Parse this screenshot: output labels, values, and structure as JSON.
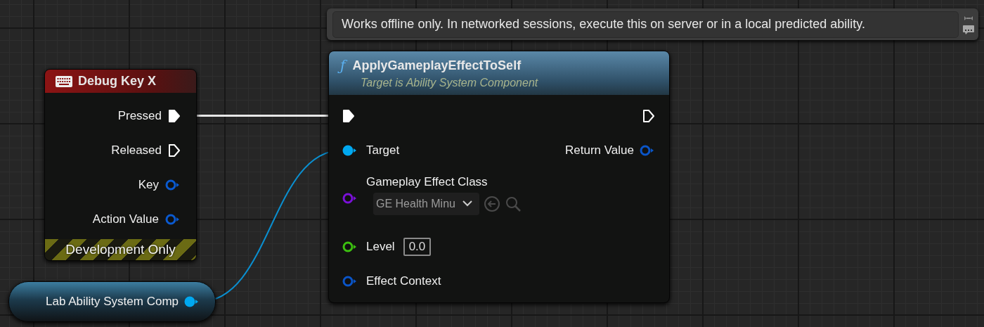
{
  "tooltip": {
    "text": "Works offline only. In networked sessions, execute this on server or in a local predicted ability."
  },
  "nodes": [
    {
      "kind": "event",
      "title": "Debug Key X",
      "footer": "Development Only",
      "outputs": [
        {
          "kind": "exec",
          "label": "Pressed",
          "connected": true
        },
        {
          "kind": "exec",
          "label": "Released",
          "connected": false
        },
        {
          "kind": "data",
          "label": "Key",
          "connected": false,
          "color": "#0a5ad0"
        },
        {
          "kind": "data",
          "label": "Action Value",
          "connected": false,
          "color": "#0a5ad0"
        }
      ]
    },
    {
      "kind": "function",
      "glyph": "ƒ",
      "title": "ApplyGameplayEffectToSelf",
      "subtitle": "Target is Ability System Component",
      "inputs": [
        {
          "kind": "exec",
          "connected": true
        },
        {
          "kind": "data",
          "label": "Target",
          "connected": true,
          "color": "#00a8f0"
        },
        {
          "kind": "class",
          "label": "Gameplay Effect Class",
          "connected": false,
          "color": "#7a10d8",
          "value": "GE Health Minu"
        },
        {
          "kind": "number",
          "label": "Level",
          "connected": false,
          "color": "#3cc010",
          "value": "0.0"
        },
        {
          "kind": "data",
          "label": "Effect Context",
          "connected": false,
          "color": "#0a55c8"
        }
      ],
      "outputs": [
        {
          "kind": "exec",
          "connected": false
        },
        {
          "kind": "data",
          "label": "Return Value",
          "connected": false,
          "color": "#0a55c8"
        }
      ]
    },
    {
      "kind": "variable",
      "label": "Lab Ability System Comp",
      "outputs": [
        {
          "kind": "data",
          "connected": true,
          "color": "#00a8f0"
        }
      ]
    }
  ],
  "wires": [
    {
      "kind": "exec",
      "color": "#e8e8e8"
    },
    {
      "kind": "data",
      "color": "#0a8fd0"
    }
  ]
}
